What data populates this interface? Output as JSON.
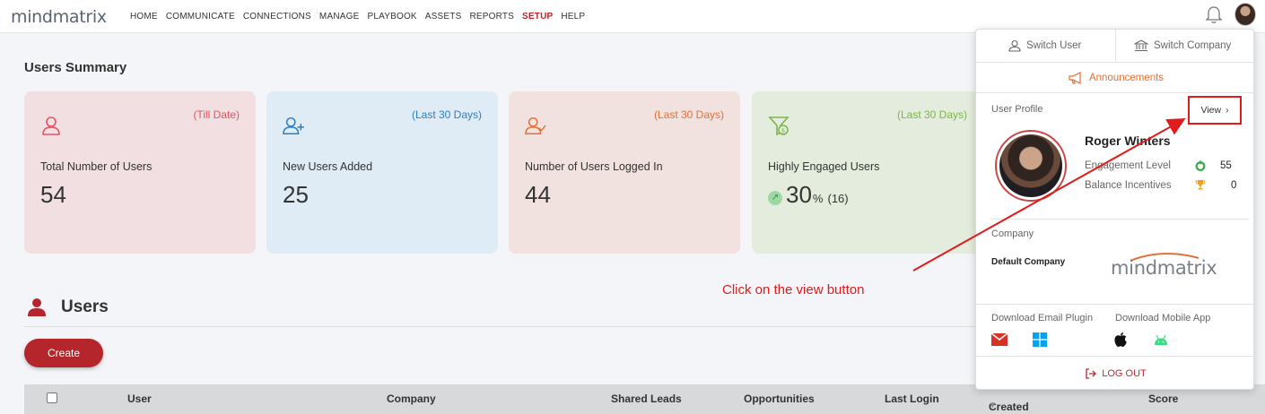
{
  "app": {
    "logo": "mindmatrix",
    "nav": [
      "HOME",
      "COMMUNICATE",
      "CONNECTIONS",
      "MANAGE",
      "PLAYBOOK",
      "ASSETS",
      "REPORTS",
      "SETUP",
      "HELP"
    ],
    "active_nav": "SETUP",
    "icons": {
      "bell": "bell-icon",
      "avatar": "user-avatar"
    }
  },
  "summary": {
    "title": "Users Summary",
    "cards": [
      {
        "period": "(Till Date)",
        "label": "Total Number of Users",
        "value": "54",
        "icon": "user-icon",
        "color": "#e05560"
      },
      {
        "period": "(Last 30 Days)",
        "label": "New Users Added",
        "value": "25",
        "icon": "user-add-icon",
        "color": "#2f7fc0"
      },
      {
        "period": "(Last 30 Days)",
        "label": "Number of Users Logged In",
        "value": "44",
        "icon": "user-check-icon",
        "color": "#e2703a"
      },
      {
        "period": "(Last 30 Days)",
        "label": "Highly Engaged Users",
        "value": "30",
        "unit": "%",
        "count": "(16)",
        "icon": "funnel-dollar-icon",
        "color": "#7ab648"
      }
    ]
  },
  "users": {
    "title": "Users",
    "create_label": "Create",
    "columns": [
      "User",
      "Company",
      "Shared Leads",
      "Opportunities",
      "Last Login",
      "Created On",
      "Score"
    ]
  },
  "panel": {
    "switch_user": "Switch User",
    "switch_company": "Switch Company",
    "announcements": "Announcements",
    "user_profile_label": "User Profile",
    "view_label": "View",
    "user_name": "Roger Winters",
    "engagement_label": "Engagement Level",
    "engagement_value": "55",
    "balance_label": "Balance Incentives",
    "balance_value": "0",
    "company_label": "Company",
    "company_name": "Default Company",
    "company_logo": "mindmatrix",
    "download_email": "Download Email Plugin",
    "download_mobile": "Download Mobile App",
    "logout_label": "LOG OUT"
  },
  "annotation": {
    "text": "Click on the view button",
    "color": "#e01b1b"
  }
}
